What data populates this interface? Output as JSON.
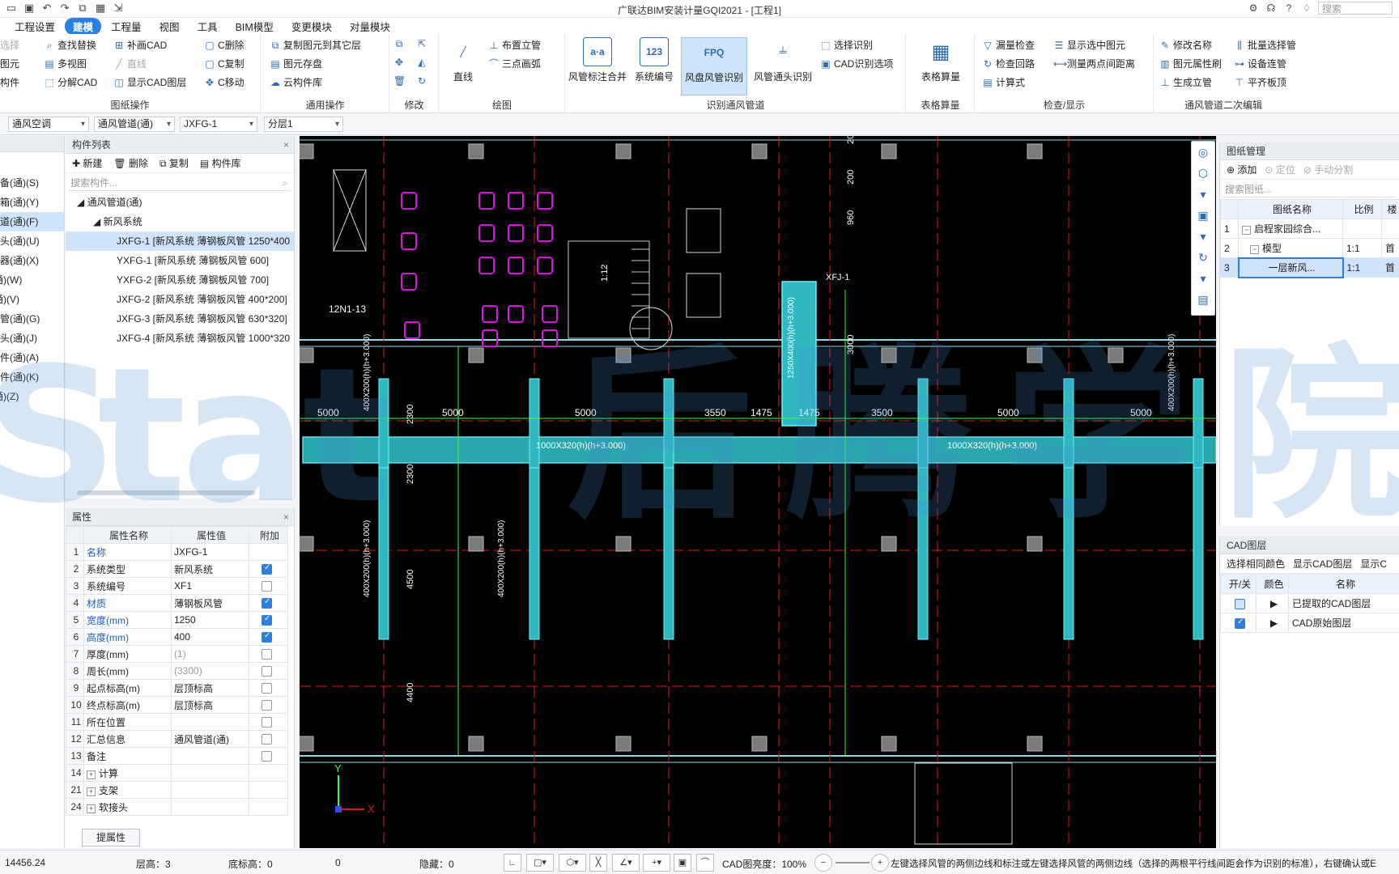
{
  "titlebar": {
    "title": "广联达BIM安装计量GQI2021 - [工程1]",
    "search_placeholder": "搜索"
  },
  "menu": [
    "工程设置",
    "建模",
    "工程量",
    "视图",
    "工具",
    "BIM模型",
    "变更模块",
    "对量模块"
  ],
  "ribbon": {
    "drawing_ops": {
      "label": "图纸操作",
      "items": [
        "选择",
        "查找替换",
        "补画CAD",
        "C删除",
        "图元",
        "多视图",
        "直线",
        "C复制",
        "构件",
        "分解CAD",
        "显示CAD图层",
        "C移动"
      ]
    },
    "common_ops": {
      "label": "通用操作",
      "items": [
        "复制图元到其它层",
        "图元存盘",
        "云构件库"
      ]
    },
    "modify": {
      "label": "修改"
    },
    "draw": {
      "label": "绘图",
      "line": "直线",
      "riser": "布置立管",
      "arc": "三点画弧"
    },
    "identify": {
      "label": "识别通风管道",
      "btns": [
        "风管标注合并",
        "系统编号",
        "风盘风管识别",
        "风管通头识别"
      ],
      "select_identify": "选择识别",
      "cad_options": "CAD识别选项"
    },
    "table": {
      "label": "表格算量",
      "btn": "表格算量"
    },
    "check": {
      "label": "检查/显示",
      "items": [
        "漏量检查",
        "显示选中图元",
        "检查回路",
        "测量两点间距离",
        "计算式"
      ]
    },
    "edit2": {
      "label": "通风管道二次编辑",
      "items": [
        "修改名称",
        "批量选择管",
        "图元属性刷",
        "设备连管",
        "生成立管",
        "平齐板顶"
      ]
    }
  },
  "filters": [
    "通风空调",
    "通风管道(通)",
    "JXFG-1",
    "分层1"
  ],
  "leftnav": [
    "设备(通)(S)",
    "压箱(通)(Y)",
    "管道(通)(F)",
    "通头(通)(U)",
    "声器(通)(X)",
    "(通)(W)",
    "(通)(V)",
    "水管(通)(G)",
    "通头(通)(J)",
    "部件(通)(A)",
    "构件(通)(K)",
    "(通)(Z)"
  ],
  "complist": {
    "title": "构件列表",
    "tools": [
      "新建",
      "删除",
      "复制",
      "构件库"
    ],
    "search_placeholder": "搜索构件...",
    "root": "通风管道(通)",
    "group": "新风系统",
    "items": [
      "JXFG-1 [新风系统 薄钢板风管 1250*400",
      "YXFG-1 [新风系统 薄钢板风管 600]",
      "YXFG-2 [新风系统 薄钢板风管 700]",
      "JXFG-2 [新风系统 薄钢板风管 400*200]",
      "JXFG-3 [新风系统 薄钢板风管 630*320]",
      "JXFG-4 [新风系统 薄钢板风管 1000*320"
    ]
  },
  "props": {
    "title": "属性",
    "headers": [
      "属性名称",
      "属性值",
      "附加"
    ],
    "rows": [
      {
        "n": "1",
        "name": "名称",
        "val": "JXFG-1",
        "chk": ""
      },
      {
        "n": "2",
        "name": "系统类型",
        "val": "新风系统",
        "chk": "on"
      },
      {
        "n": "3",
        "name": "系统编号",
        "val": "XF1",
        "chk": "off"
      },
      {
        "n": "4",
        "name": "材质",
        "val": "薄钢板风管",
        "chk": "on"
      },
      {
        "n": "5",
        "name": "宽度(mm)",
        "val": "1250",
        "chk": "on"
      },
      {
        "n": "6",
        "name": "高度(mm)",
        "val": "400",
        "chk": "on"
      },
      {
        "n": "7",
        "name": "厚度(mm)",
        "val": "(1)",
        "chk": "off"
      },
      {
        "n": "8",
        "name": "周长(mm)",
        "val": "(3300)",
        "chk": "off"
      },
      {
        "n": "9",
        "name": "起点标高(m)",
        "val": "层顶标高",
        "chk": "off"
      },
      {
        "n": "10",
        "name": "终点标高(m)",
        "val": "层顶标高",
        "chk": "off"
      },
      {
        "n": "11",
        "name": "所在位置",
        "val": "",
        "chk": "off"
      },
      {
        "n": "12",
        "name": "汇总信息",
        "val": "通风管道(通)",
        "chk": "off"
      },
      {
        "n": "13",
        "name": "备注",
        "val": "",
        "chk": "off"
      },
      {
        "n": "14",
        "name": "计算",
        "val": "",
        "chk": ""
      },
      {
        "n": "21",
        "name": "支架",
        "val": "",
        "chk": ""
      },
      {
        "n": "24",
        "name": "软接头",
        "val": "",
        "chk": ""
      }
    ],
    "button": "提属性"
  },
  "drawing_mgr": {
    "title": "图纸管理",
    "tools": [
      "添加",
      "定位",
      "手动分割"
    ],
    "search_placeholder": "搜索图纸...",
    "headers": [
      "图纸名称",
      "比例",
      "楼"
    ],
    "rows": [
      {
        "n": "1",
        "name": "启程家园综合...",
        "scale": "",
        "floor": ""
      },
      {
        "n": "2",
        "name": "模型",
        "scale": "1:1",
        "floor": "首"
      },
      {
        "n": "3",
        "name": "一层新风...",
        "scale": "1:1",
        "floor": "首"
      }
    ]
  },
  "cad_layer": {
    "title": "CAD图层",
    "tools": [
      "选择相同颜色",
      "显示CAD图层",
      "显示C"
    ],
    "headers": [
      "开/关",
      "颜色",
      "名称"
    ],
    "rows": [
      {
        "name": "已提取的CAD图层",
        "on": false
      },
      {
        "name": "CAD原始图层",
        "on": true
      }
    ]
  },
  "status": {
    "coord": "14456.24",
    "floor_height": "层高：3",
    "bottom_elev": "底标高：0",
    "zero": "0",
    "hidden": "隐藏：0",
    "brightness": "CAD图亮度：100%",
    "hint": "左键选择风管的两侧边线和标注或左键选择风管的两侧边线（选择的两根平行线间距会作为识别的标准），右键确认或E"
  },
  "canvas": {
    "dims_top": [
      "5000",
      "5000",
      "5000",
      "3550",
      "1475",
      "1475",
      "3500",
      "5000",
      "5000"
    ],
    "labels": [
      "1000X320(h)(h+3.000)",
      "1000X320(h)(h+3.000)",
      "400X200(h)(h+3.000)",
      "1250X400(h)(h+3.000)",
      "2300",
      "2300",
      "4500",
      "4400",
      "3000",
      "960",
      "200",
      "200",
      "12N1-13",
      "1:12",
      "XFJ-1"
    ],
    "watermark": "Stat后腾学院"
  },
  "colors": {
    "accent": "#2b7fe0",
    "duct": "#2fb8c0",
    "duct_edge": "#6ef2ff",
    "wall": "#8fd8e8",
    "magenta": "#e010e0",
    "green": "#39ff39",
    "red": "#e01818"
  }
}
